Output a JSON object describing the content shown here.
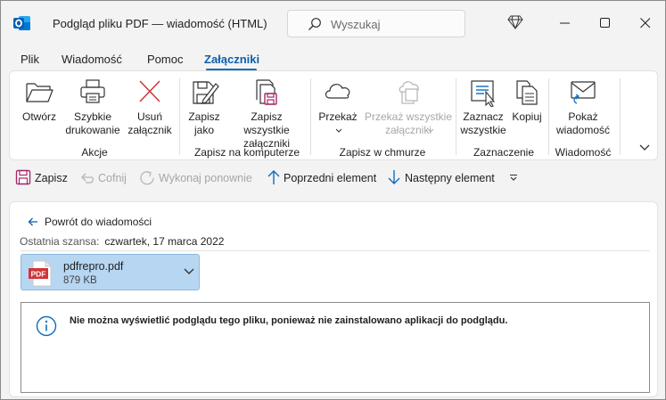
{
  "window": {
    "title": "Podgląd pliku PDF — wiadomość (HTML)"
  },
  "search": {
    "placeholder": "Wyszukaj"
  },
  "menu": {
    "tabs": [
      {
        "label": "Plik"
      },
      {
        "label": "Wiadomość"
      },
      {
        "label": "Pomoc"
      },
      {
        "label": "Załączniki",
        "active": true
      }
    ]
  },
  "ribbon": {
    "groups": {
      "actions": "Akcje",
      "save_computer": "Zapisz na komputerze",
      "save_cloud": "Zapisz w chmurze",
      "selection": "Zaznaczenie",
      "message": "Wiadomość"
    },
    "buttons": {
      "open": "Otwórz",
      "quick_print": "Szybkie drukowanie",
      "remove": "Usuń załącznik",
      "save_as": "Zapisz jako",
      "save_all": "Zapisz wszystkie załączniki",
      "forward": "Przekaż",
      "forward_all": "Przekaż wszystkie załączniki",
      "select_all": "Zaznacz wszystkie",
      "copy": "Kopiuj",
      "show_message": "Pokaż wiadomość"
    }
  },
  "quickbar": {
    "save": "Zapisz",
    "undo": "Cofnij",
    "redo": "Wykonaj ponownie",
    "previous": "Poprzedni element",
    "next": "Następny element"
  },
  "content": {
    "back": "Powrót do wiadomości",
    "last_chance_label": "Ostatnia szansa:",
    "last_chance_value": "czwartek, 17 marca 2022",
    "attachment": {
      "badge": "PDF",
      "name": "pdfrepro.pdf",
      "size": "879 KB"
    },
    "notice": "Nie można wyświetlić podglądu tego pliku, ponieważ nie zainstalowano aplikacji do podglądu."
  },
  "colors": {
    "accent": "#0f6cbd",
    "remove_red": "#d13438",
    "attachment_bg": "#b7d6f2",
    "save_purple": "#a4286a"
  }
}
